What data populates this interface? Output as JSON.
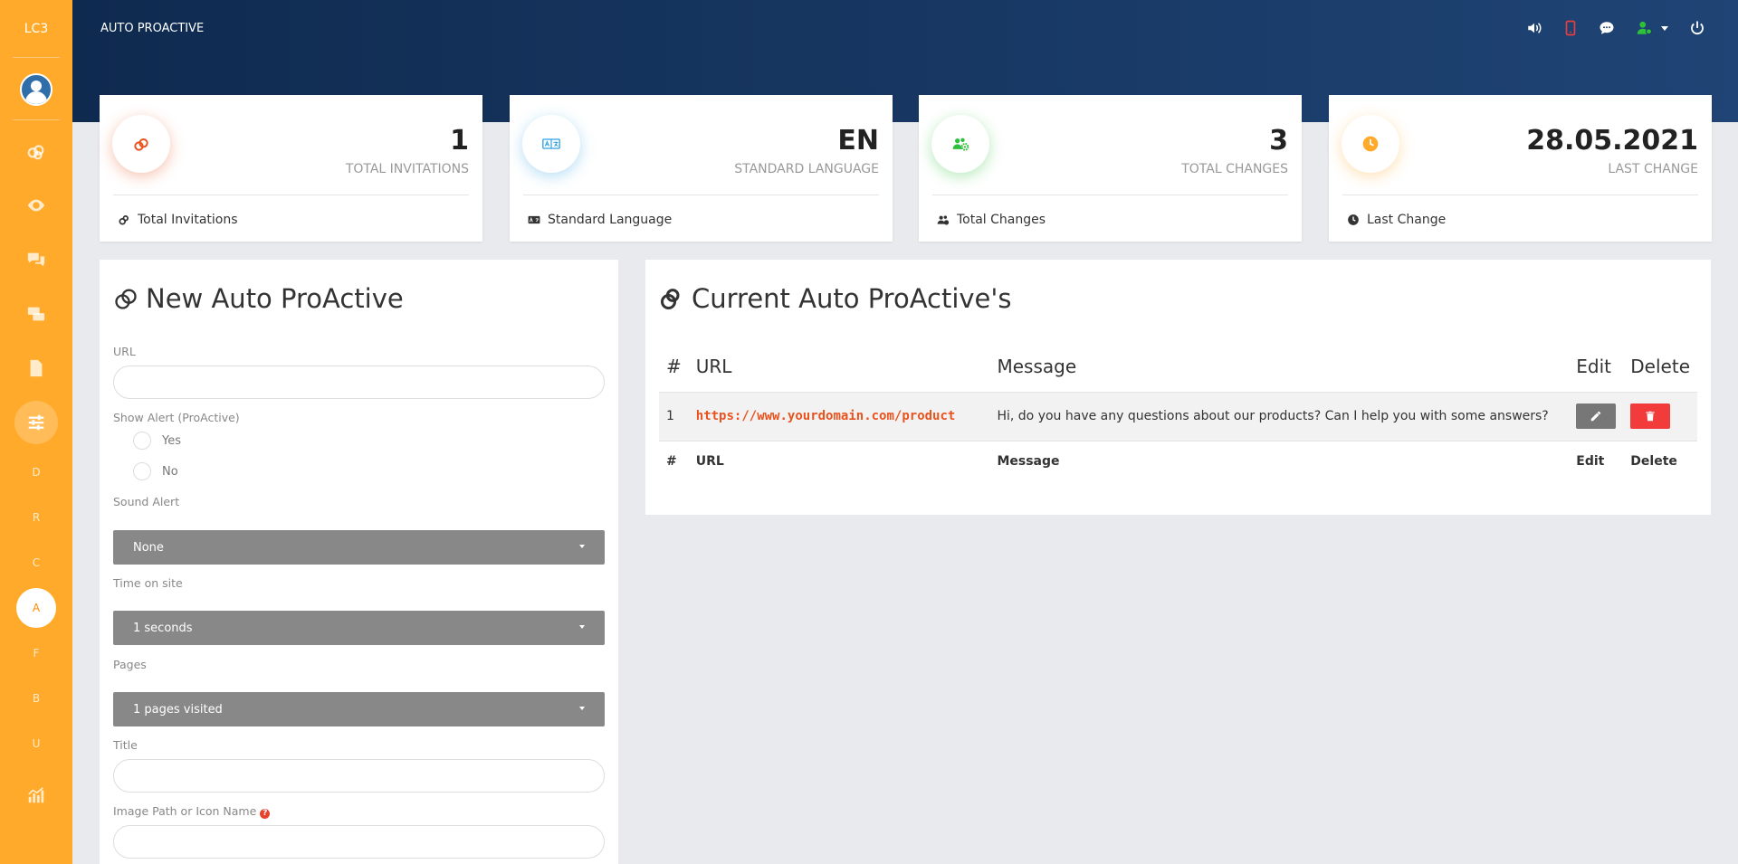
{
  "sidebar": {
    "logo": "LC3",
    "letters": [
      "D",
      "R",
      "C",
      "A",
      "F",
      "B",
      "U"
    ]
  },
  "header": {
    "title": "AUTO PROACTIVE"
  },
  "stats": [
    {
      "value": "1",
      "label": "TOTAL INVITATIONS",
      "footer": "Total Invitations",
      "color": "#e9531e"
    },
    {
      "value": "EN",
      "label": "STANDARD LANGUAGE",
      "footer": "Standard Language",
      "color": "#2fa0e0"
    },
    {
      "value": "3",
      "label": "TOTAL CHANGES",
      "footer": "Total Changes",
      "color": "#2fbf3a"
    },
    {
      "value": "28.05.2021",
      "label": "LAST CHANGE",
      "footer": "Last Change",
      "color": "#ffaa2b"
    }
  ],
  "form": {
    "title": "New Auto ProActive",
    "url_label": "URL",
    "url_value": "",
    "alert_label": "Show Alert (ProActive)",
    "opt_yes": "Yes",
    "opt_no": "No",
    "sound_label": "Sound Alert",
    "sound_value": "None",
    "time_label": "Time on site",
    "time_value": "1 seconds",
    "pages_label": "Pages",
    "pages_value": "1 pages visited",
    "title_label": "Title",
    "title_value": "",
    "image_label": "Image Path or Icon Name",
    "image_value": ""
  },
  "list": {
    "title": "Current Auto ProActive's",
    "columns": [
      "#",
      "URL",
      "Message",
      "Edit",
      "Delete"
    ],
    "rows": [
      {
        "num": "1",
        "url": "https://www.yourdomain.com/product",
        "message": "Hi, do you have any questions about our products? Can I help you with some answers?"
      }
    ]
  },
  "colors": {
    "sidebar": "#ffaa2b",
    "header_start": "#0f2a4f",
    "header_end": "#1f4475",
    "link": "#e9531e",
    "delete": "#f23b3b",
    "user_status": "#2fbf3a",
    "mobile": "#e84040"
  }
}
